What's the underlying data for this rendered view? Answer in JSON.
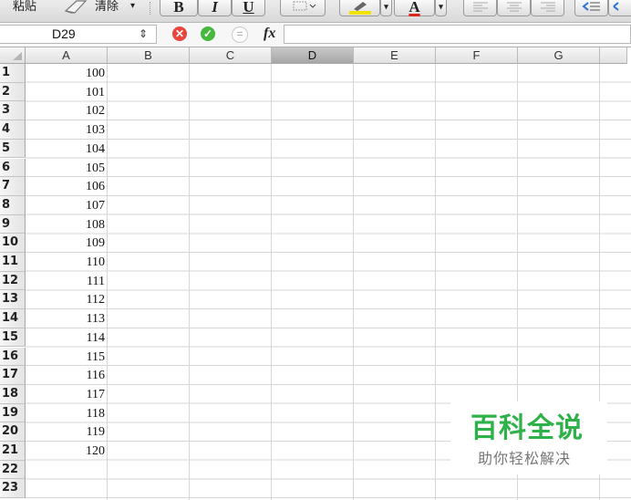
{
  "toolbar": {
    "paste_label": "粘贴",
    "clear_label": "清除",
    "clear_dropdown": "▾",
    "bold_label": "B",
    "italic_label": "I",
    "underline_label": "U",
    "font_color_label": "A"
  },
  "formula_bar": {
    "name_box_value": "D29",
    "stepper": "⇕",
    "cancel_symbol": "✕",
    "confirm_symbol": "✓",
    "equals_symbol": "=",
    "fx_label": "fx",
    "formula_value": ""
  },
  "columns": [
    "A",
    "B",
    "C",
    "D",
    "E",
    "F",
    "G"
  ],
  "selected_column": "D",
  "rows": [
    "1",
    "2",
    "3",
    "4",
    "5",
    "6",
    "7",
    "8",
    "9",
    "10",
    "11",
    "12",
    "13",
    "14",
    "15",
    "16",
    "17",
    "18",
    "19",
    "20",
    "21",
    "22",
    "23"
  ],
  "column_a_values": [
    "100",
    "101",
    "102",
    "103",
    "104",
    "105",
    "106",
    "107",
    "108",
    "109",
    "110",
    "111",
    "112",
    "113",
    "114",
    "115",
    "116",
    "117",
    "118",
    "119",
    "120"
  ],
  "watermark": {
    "title": "百科全说",
    "subtitle": "助你轻松解决"
  },
  "colors": {
    "cancel": "#e8453c",
    "confirm": "#46b83d",
    "highlight": "#f2e200",
    "font_color": "#d9261c",
    "watermark_green": "#2fb14a"
  }
}
